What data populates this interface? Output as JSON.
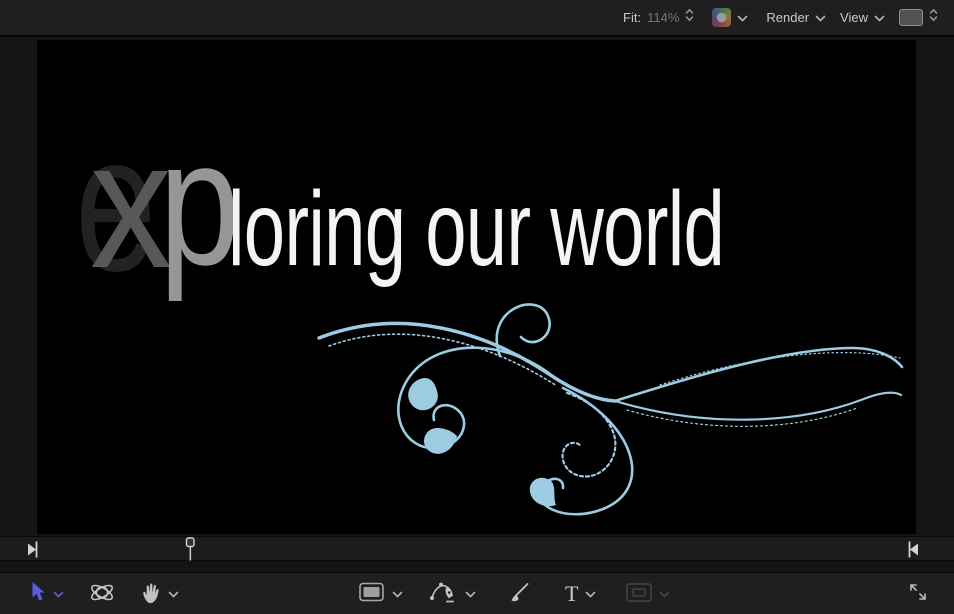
{
  "top_toolbar": {
    "fit_label": "Fit:",
    "fit_value": "114%",
    "render_label": "Render",
    "view_label": "View"
  },
  "canvas": {
    "background": "#000000",
    "title": {
      "full_text": "exploring our world",
      "letter_faded": "e",
      "letter_mid": "x",
      "letter_bright": "p",
      "text_rest": "loring our world",
      "text_color": "#f4f4f4"
    },
    "flourish_color": "#9ccbe2"
  },
  "bottom_toolbar": {
    "text_tool_glyph": "T"
  },
  "colors": {
    "accent_blue": "#5e5ce6",
    "toolbar_bg": "#1f1f1f",
    "window_bg": "#141414",
    "icon_gray": "#c2c2c2"
  }
}
